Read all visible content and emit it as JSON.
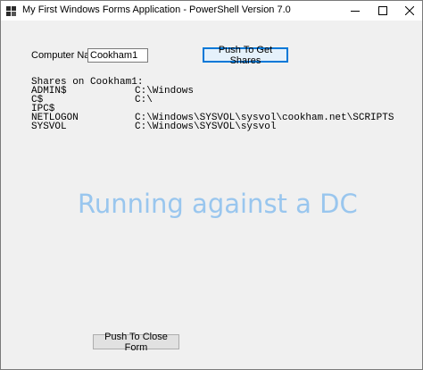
{
  "window": {
    "title": "My First Windows Forms Application - PowerShell Version 7.0",
    "icon": "powershell-app-icon",
    "controls": [
      "minimize-icon",
      "maximize-icon",
      "close-icon"
    ]
  },
  "form": {
    "computer_label": "Computer Name:",
    "computer_value": "Cookham1",
    "get_shares_label": "Push To Get Shares",
    "output_header": "Shares on Cookham1:",
    "shares": [
      {
        "name": "ADMIN$",
        "path": "C:\\Windows"
      },
      {
        "name": "C$",
        "path": "C:\\"
      },
      {
        "name": "IPC$",
        "path": ""
      },
      {
        "name": "NETLOGON",
        "path": "C:\\Windows\\SYSVOL\\sysvol\\cookham.net\\SCRIPTS"
      },
      {
        "name": "SYSVOL",
        "path": "C:\\Windows\\SYSVOL\\sysvol"
      }
    ],
    "status_banner": "Running against a DC",
    "close_form_label": "Push To Close Form"
  },
  "colors": {
    "banner": "#99c6ee",
    "focus_border": "#0078d7",
    "form_background": "#f0f0f0"
  }
}
